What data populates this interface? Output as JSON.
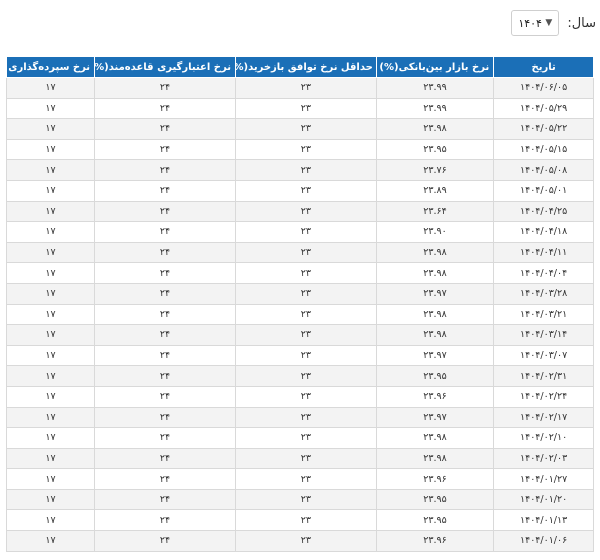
{
  "year_filter": {
    "label": "سال:",
    "selected": "۱۴۰۴"
  },
  "table": {
    "headers": [
      "تاریخ",
      "نرخ بازار بین‌بانکی(%)",
      "حداقل نرخ توافق بازخرید(%)",
      "نرخ اعتبارگیری قاعده‌مند(%)",
      "نرخ سپرده‌گذاری قاعده‌مند(%)"
    ],
    "rows": [
      [
        "۱۴۰۴/۰۶/۰۵",
        "۲۳.۹۹",
        "۲۳",
        "۲۴",
        "۱۷"
      ],
      [
        "۱۴۰۴/۰۵/۲۹",
        "۲۳.۹۹",
        "۲۳",
        "۲۴",
        "۱۷"
      ],
      [
        "۱۴۰۴/۰۵/۲۲",
        "۲۳.۹۸",
        "۲۳",
        "۲۴",
        "۱۷"
      ],
      [
        "۱۴۰۴/۰۵/۱۵",
        "۲۳.۹۵",
        "۲۳",
        "۲۴",
        "۱۷"
      ],
      [
        "۱۴۰۴/۰۵/۰۸",
        "۲۳.۷۶",
        "۲۳",
        "۲۴",
        "۱۷"
      ],
      [
        "۱۴۰۴/۰۵/۰۱",
        "۲۳.۸۹",
        "۲۳",
        "۲۴",
        "۱۷"
      ],
      [
        "۱۴۰۴/۰۴/۲۵",
        "۲۳.۶۴",
        "۲۳",
        "۲۴",
        "۱۷"
      ],
      [
        "۱۴۰۴/۰۴/۱۸",
        "۲۳.۹۰",
        "۲۳",
        "۲۴",
        "۱۷"
      ],
      [
        "۱۴۰۴/۰۴/۱۱",
        "۲۳.۹۸",
        "۲۳",
        "۲۴",
        "۱۷"
      ],
      [
        "۱۴۰۴/۰۴/۰۴",
        "۲۳.۹۸",
        "۲۳",
        "۲۴",
        "۱۷"
      ],
      [
        "۱۴۰۴/۰۳/۲۸",
        "۲۳.۹۷",
        "۲۳",
        "۲۴",
        "۱۷"
      ],
      [
        "۱۴۰۴/۰۳/۲۱",
        "۲۳.۹۸",
        "۲۳",
        "۲۴",
        "۱۷"
      ],
      [
        "۱۴۰۴/۰۳/۱۴",
        "۲۳.۹۸",
        "۲۳",
        "۲۴",
        "۱۷"
      ],
      [
        "۱۴۰۴/۰۳/۰۷",
        "۲۳.۹۷",
        "۲۳",
        "۲۴",
        "۱۷"
      ],
      [
        "۱۴۰۴/۰۲/۳۱",
        "۲۳.۹۵",
        "۲۳",
        "۲۴",
        "۱۷"
      ],
      [
        "۱۴۰۴/۰۲/۲۴",
        "۲۳.۹۶",
        "۲۳",
        "۲۴",
        "۱۷"
      ],
      [
        "۱۴۰۴/۰۲/۱۷",
        "۲۳.۹۷",
        "۲۳",
        "۲۴",
        "۱۷"
      ],
      [
        "۱۴۰۴/۰۲/۱۰",
        "۲۳.۹۸",
        "۲۳",
        "۲۴",
        "۱۷"
      ],
      [
        "۱۴۰۴/۰۲/۰۳",
        "۲۳.۹۸",
        "۲۳",
        "۲۴",
        "۱۷"
      ],
      [
        "۱۴۰۴/۰۱/۲۷",
        "۲۳.۹۶",
        "۲۳",
        "۲۴",
        "۱۷"
      ],
      [
        "۱۴۰۴/۰۱/۲۰",
        "۲۳.۹۵",
        "۲۳",
        "۲۴",
        "۱۷"
      ],
      [
        "۱۴۰۴/۰۱/۱۳",
        "۲۳.۹۵",
        "۲۳",
        "۲۴",
        "۱۷"
      ],
      [
        "۱۴۰۴/۰۱/۰۶",
        "۲۳.۹۶",
        "۲۳",
        "۲۴",
        "۱۷"
      ]
    ]
  }
}
